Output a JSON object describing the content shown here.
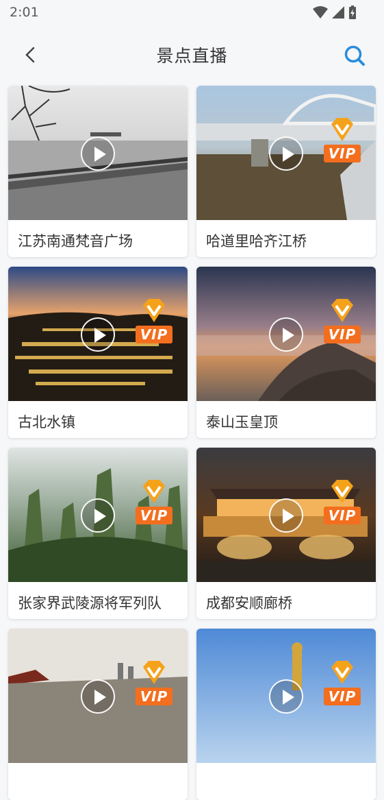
{
  "status": {
    "time": "2:01"
  },
  "header": {
    "title": "景点直播",
    "back_icon": "chevron-left-icon",
    "search_icon": "search-icon",
    "accent": "#2a8cdc"
  },
  "cards": [
    {
      "title": "江苏南通梵音广场",
      "vip": false
    },
    {
      "title": "哈道里哈齐江桥",
      "vip": true
    },
    {
      "title": "古北水镇",
      "vip": true
    },
    {
      "title": "泰山玉皇顶",
      "vip": true
    },
    {
      "title": "张家界武陵源将军列队",
      "vip": true
    },
    {
      "title": "成都安顺廊桥",
      "vip": true
    },
    {
      "title": "",
      "vip": true
    },
    {
      "title": "",
      "vip": true
    }
  ],
  "vip_badge": {
    "label": "VIP",
    "color": "#f36e1e"
  }
}
